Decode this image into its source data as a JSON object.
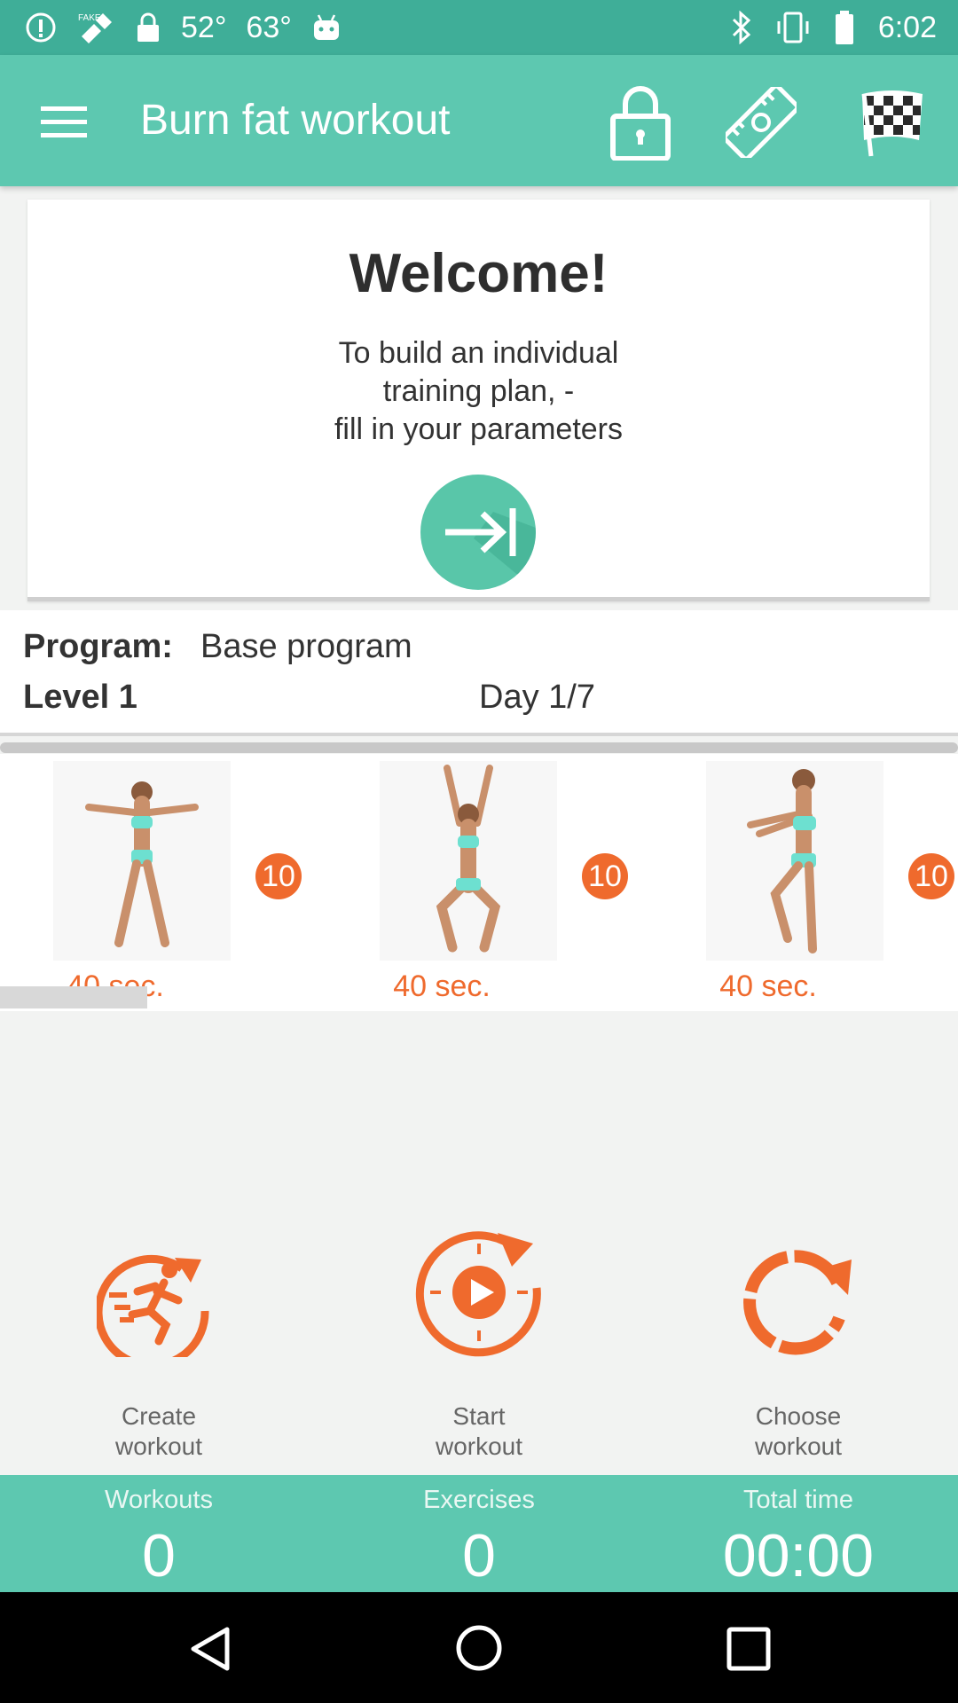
{
  "status_bar": {
    "temps": [
      "52°",
      "63°"
    ],
    "time": "6:02",
    "fake_label": "FAKE"
  },
  "app_bar": {
    "title": "Burn fat workout",
    "icons": [
      "menu-icon",
      "lock-icon",
      "measuring-tape-icon",
      "checkered-flag-icon"
    ]
  },
  "welcome": {
    "title": "Welcome!",
    "text": "To build an individual\ntraining plan, -\nfill in your parameters"
  },
  "program": {
    "program_label": "Program:",
    "program_value": "Base program",
    "level": "Level 1",
    "day": "Day 1/7"
  },
  "exercises": [
    {
      "reps": "10",
      "duration": "40 sec."
    },
    {
      "reps": "10",
      "duration": "40 sec."
    },
    {
      "reps": "10",
      "duration": "40 sec."
    }
  ],
  "actions": [
    {
      "label": "Create\nworkout",
      "icon": "running-person-icon"
    },
    {
      "label": "Start\nworkout",
      "icon": "play-refresh-icon"
    },
    {
      "label": "Choose\nworkout",
      "icon": "refresh-icon"
    }
  ],
  "stats": [
    {
      "label": "Workouts",
      "value": "0"
    },
    {
      "label": "Exercises",
      "value": "0"
    },
    {
      "label": "Total time",
      "value": "00:00"
    }
  ],
  "colors": {
    "teal": "#5dc8b0",
    "status_teal": "#3fae98",
    "accent": "#ef6a2d"
  }
}
